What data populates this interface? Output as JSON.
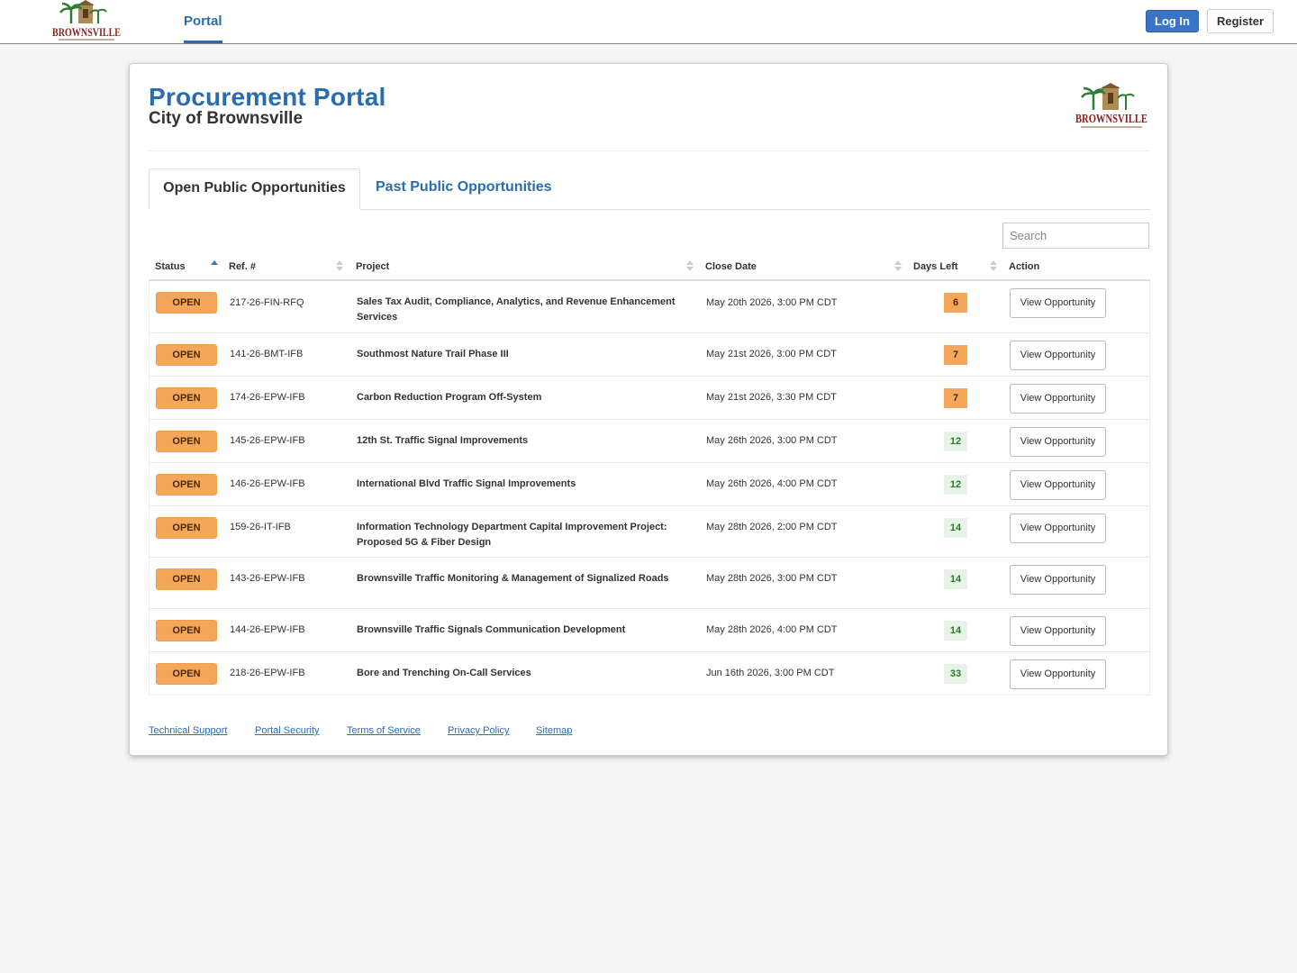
{
  "brand": {
    "logo_text": "BROWNSVILLE",
    "logo_icon": "brownsville-logo",
    "colors": {
      "logo_red": "#8b1d1d",
      "logo_green": "#2e7d32",
      "logo_tan": "#b08a55"
    }
  },
  "topbar": {
    "nav_portal": "Portal",
    "login_label": "Log In",
    "register_label": "Register"
  },
  "header": {
    "title": "Procurement Portal",
    "subtitle": "City of Brownsville"
  },
  "tabs": [
    {
      "label": "Open Public Opportunities",
      "active": true
    },
    {
      "label": "Past Public Opportunities",
      "active": false
    }
  ],
  "search": {
    "placeholder": "Search",
    "value": ""
  },
  "table": {
    "columns": [
      "Status",
      "Ref. #",
      "Project",
      "Close Date",
      "Days Left",
      "Action"
    ],
    "sort": {
      "column": "Status",
      "direction": "asc"
    },
    "rows": [
      {
        "status": "OPEN",
        "ref": "217-26-FIN-RFQ",
        "project": "Sales Tax Audit, Compliance, Analytics, and Revenue Enhancement Services",
        "close_date": "May 20th 2026, 3:00 PM CDT",
        "days_left": "6",
        "days_level": "warn",
        "action": "View Opportunity"
      },
      {
        "status": "OPEN",
        "ref": "141-26-BMT-IFB",
        "project": "Southmost Nature Trail Phase III",
        "close_date": "May 21st 2026, 3:00 PM CDT",
        "days_left": "7",
        "days_level": "warn",
        "action": "View Opportunity"
      },
      {
        "status": "OPEN",
        "ref": "174-26-EPW-IFB",
        "project": "Carbon Reduction Program Off-System",
        "close_date": "May 21st 2026, 3:30 PM CDT",
        "days_left": "7",
        "days_level": "warn",
        "action": "View Opportunity"
      },
      {
        "status": "OPEN",
        "ref": "145-26-EPW-IFB",
        "project": "12th St. Traffic Signal Improvements",
        "close_date": "May 26th 2026, 3:00 PM CDT",
        "days_left": "12",
        "days_level": "ok",
        "action": "View Opportunity"
      },
      {
        "status": "OPEN",
        "ref": "146-26-EPW-IFB",
        "project": "International Blvd Traffic Signal Improvements",
        "close_date": "May 26th 2026, 4:00 PM CDT",
        "days_left": "12",
        "days_level": "ok",
        "action": "View Opportunity"
      },
      {
        "status": "OPEN",
        "ref": "159-26-IT-IFB",
        "project": "Information Technology Department Capital Improvement Project: Proposed 5G & Fiber Design",
        "close_date": "May 28th 2026, 2:00 PM CDT",
        "days_left": "14",
        "days_level": "ok",
        "action": "View Opportunity"
      },
      {
        "status": "OPEN",
        "ref": "143-26-EPW-IFB",
        "project": "Brownsville Traffic Monitoring & Management of Signalized Roads",
        "close_date": "May 28th 2026, 3:00 PM CDT",
        "days_left": "14",
        "days_level": "ok",
        "action": "View Opportunity"
      },
      {
        "status": "OPEN",
        "ref": "144-26-EPW-IFB",
        "project": "Brownsville Traffic Signals Communication Development",
        "close_date": "May 28th 2026, 4:00 PM CDT",
        "days_left": "14",
        "days_level": "ok",
        "action": "View Opportunity"
      },
      {
        "status": "OPEN",
        "ref": "218-26-EPW-IFB",
        "project": "Bore and Trenching On-Call Services",
        "close_date": "Jun 16th 2026, 3:00 PM CDT",
        "days_left": "33",
        "days_level": "ok",
        "action": "View Opportunity"
      }
    ]
  },
  "footer": {
    "links": [
      "Technical Support",
      "Portal Security",
      "Terms of Service",
      "Privacy Policy",
      "Sitemap"
    ]
  },
  "colors": {
    "accent": "#2a6cb0",
    "primary_button": "#3b74c4",
    "status_open": "#f5a65b",
    "days_warn": "#f5a65b",
    "days_ok_bg": "#e6f3e6",
    "days_ok_text": "#2b7a2b"
  }
}
